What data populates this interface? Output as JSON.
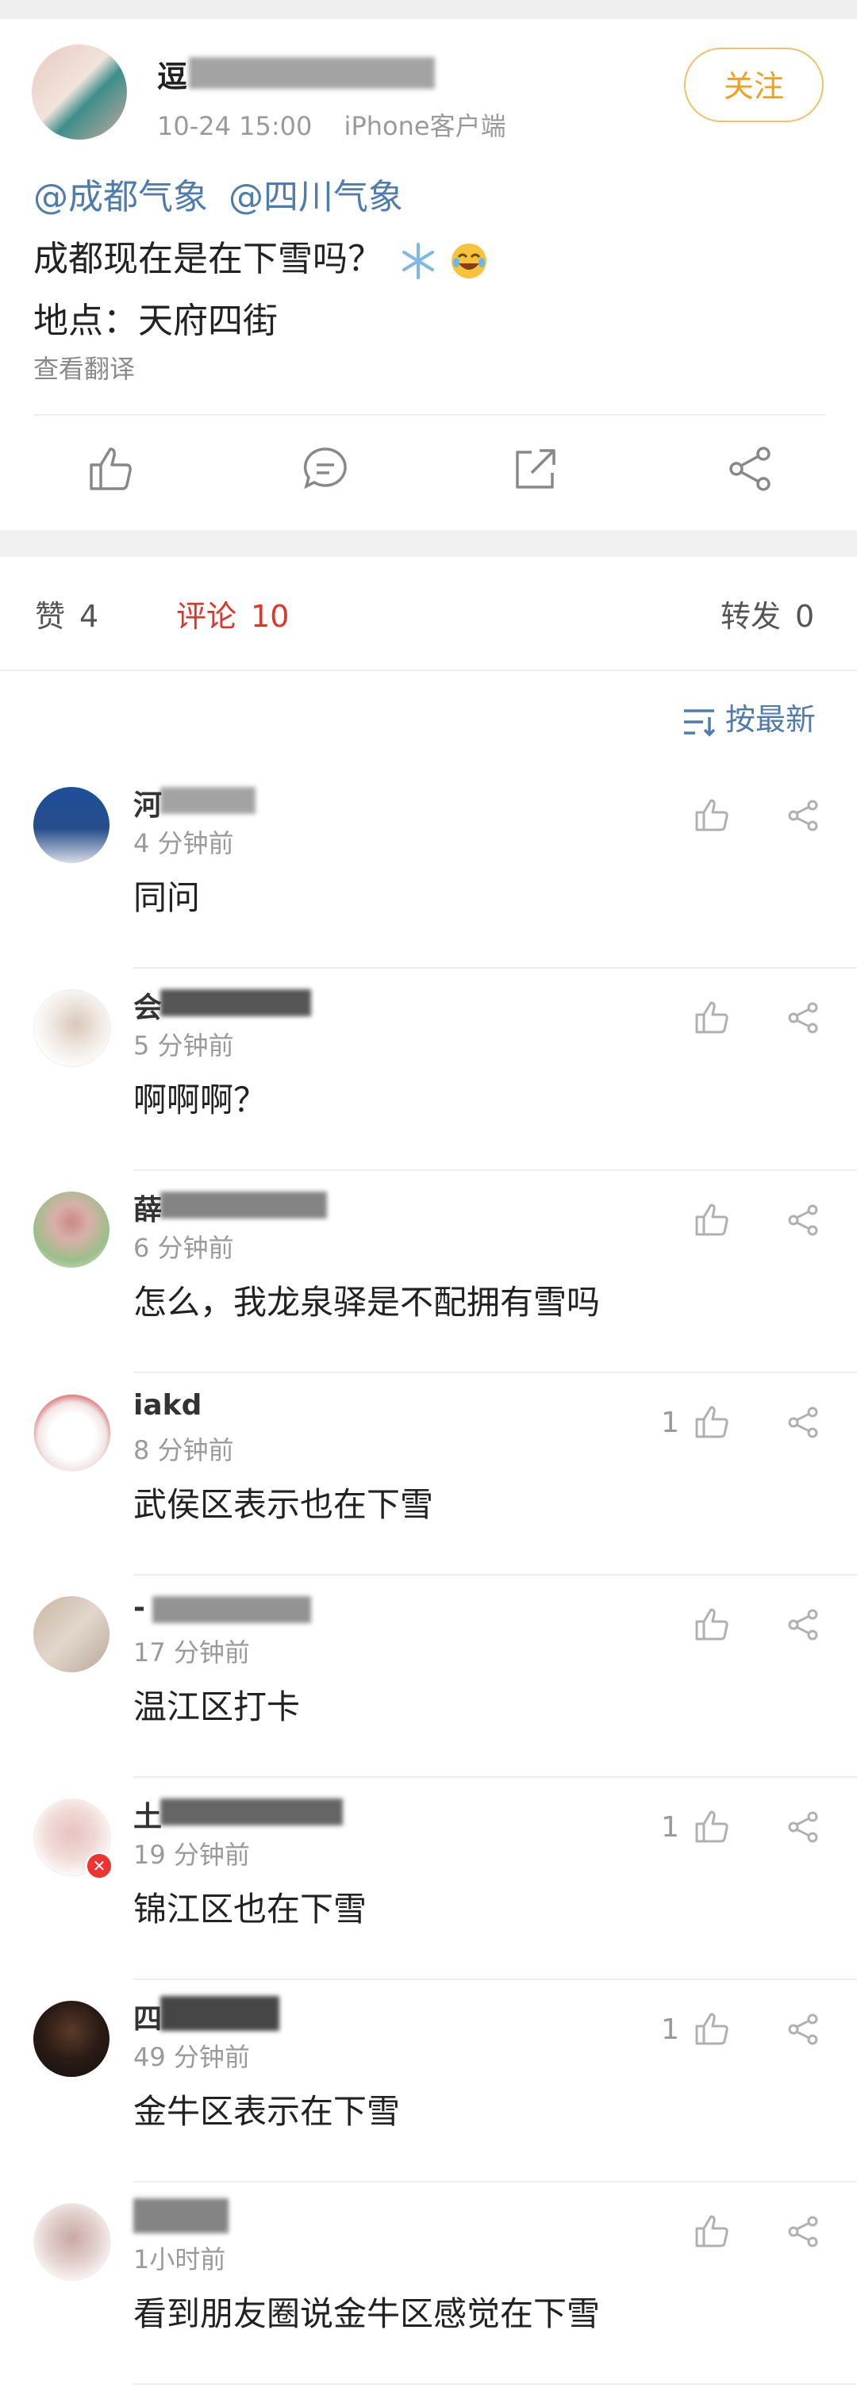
{
  "post": {
    "author_name": "逗",
    "timestamp": "10-24 15:00",
    "source": "iPhone客户端",
    "follow_label": "关注",
    "mentions": [
      "@成都气象",
      "@四川气象"
    ],
    "text_line1": "成都现在是在下雪吗？",
    "text_line2": "地点：天府四街",
    "translate_label": "查看翻译",
    "actions": [
      "like-icon",
      "comment-icon",
      "repost-icon",
      "share-icon"
    ]
  },
  "tabs": {
    "likes_label": "赞",
    "likes_count": "4",
    "comments_label": "评论",
    "comments_count": "10",
    "reposts_label": "转发",
    "reposts_count": "0"
  },
  "sort": {
    "label": "按最新"
  },
  "comments": [
    {
      "name": "河",
      "time": "4 分钟前",
      "text": "同问",
      "likes": ""
    },
    {
      "name": "会",
      "time": "5 分钟前",
      "text": "啊啊啊？",
      "likes": ""
    },
    {
      "name": "薛",
      "time": "6 分钟前",
      "text": "怎么，我龙泉驿是不配拥有雪吗",
      "likes": ""
    },
    {
      "name": "iakd",
      "time": "8 分钟前",
      "text": "武侯区表示也在下雪",
      "likes": "1"
    },
    {
      "name": "-",
      "time": "17 分钟前",
      "text": "温江区打卡",
      "likes": ""
    },
    {
      "name": "土",
      "time": "19 分钟前",
      "text": "锦江区也在下雪",
      "likes": "1"
    },
    {
      "name": "四",
      "time": "49 分钟前",
      "text": "金牛区表示在下雪",
      "likes": "1"
    },
    {
      "name": "",
      "time": "1小时前",
      "text": "看到朋友圈说金牛区感觉在下雪",
      "likes": ""
    }
  ],
  "colors": {
    "link": "#4f7cae",
    "active_tab": "#e0352a",
    "follow": "#f0a020",
    "muted": "#9a9a9a"
  }
}
